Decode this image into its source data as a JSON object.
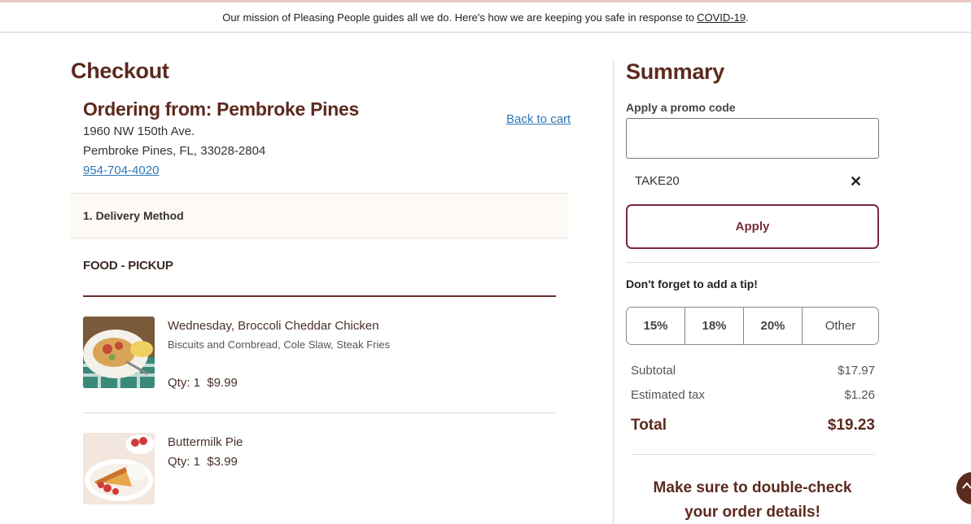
{
  "banner": {
    "text": "Our mission of Pleasing People guides all we do. Here's how we are keeping you safe in response to",
    "link": "COVID-19",
    "suffix": "."
  },
  "checkout": {
    "title": "Checkout",
    "store_title": "Ordering from: Pembroke Pines",
    "address_line1": "1960 NW 150th Ave.",
    "address_line2": "Pembroke Pines, FL, 33028-2804",
    "phone": "954-704-4020",
    "back_link": "Back to cart",
    "step": "1. Delivery Method",
    "section": "FOOD - PICKUP",
    "items": [
      {
        "name": "Wednesday, Broccoli Cheddar Chicken",
        "sides": "Biscuits and Cornbread, Cole Slaw, Steak Fries",
        "qty": "Qty: 1",
        "price": "$9.99"
      },
      {
        "name": "Buttermilk Pie",
        "sides": "",
        "qty": "Qty: 1",
        "price": "$3.99"
      }
    ]
  },
  "summary": {
    "title": "Summary",
    "promo_label": "Apply a promo code",
    "promo_placeholder": "",
    "applied_code": "TAKE20",
    "remove_icon": "✕",
    "apply_label": "Apply",
    "tip_label": "Don't forget to add a tip!",
    "tip_options": [
      "15%",
      "18%",
      "20%",
      "Other"
    ],
    "subtotal_label": "Subtotal",
    "subtotal": "$17.97",
    "tax_label": "Estimated tax",
    "tax": "$1.26",
    "total_label": "Total",
    "total": "$19.23",
    "message_line1": "Make sure to double-check",
    "message_line2": "your order details!"
  },
  "icons": {
    "scroll_top": "chevron-up-icon",
    "remove": "close-icon"
  },
  "colors": {
    "brand": "#5c2a1e",
    "link": "#2f77b8",
    "accent_border": "#7a2a3c"
  }
}
